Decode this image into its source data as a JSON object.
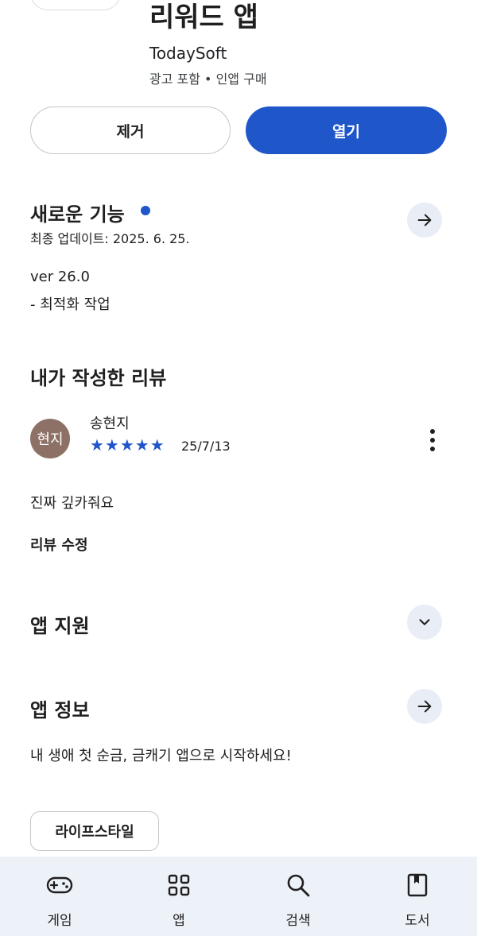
{
  "app": {
    "title": "리워드 앱",
    "developer": "TodaySoft",
    "meta": "광고 포함 • 인앱 구매"
  },
  "buttons": {
    "remove": "제거",
    "open": "열기"
  },
  "whats_new": {
    "title": "새로운 기능",
    "updated": "최종 업데이트: 2025. 6. 25.",
    "version": "ver 26.0",
    "notes": "- 최적화 작업"
  },
  "my_review": {
    "section_title": "내가 작성한 리뷰",
    "avatar_text": "현지",
    "reviewer": "송현지",
    "stars": "★★★★★",
    "rating": 5,
    "date": "25/7/13",
    "text": "진짜 깊카줘요",
    "edit_label": "리뷰 수정"
  },
  "app_support": {
    "title": "앱 지원"
  },
  "app_info": {
    "title": "앱 정보",
    "description": "내 생애 첫 순금, 금캐기 앱으로 시작하세요!",
    "category_chip": "라이프스타일"
  },
  "bottom_nav": {
    "items": [
      {
        "label": "게임",
        "icon": "gamepad-icon"
      },
      {
        "label": "앱",
        "icon": "apps-grid-icon"
      },
      {
        "label": "검색",
        "icon": "search-icon"
      },
      {
        "label": "도서",
        "icon": "book-icon"
      }
    ]
  },
  "colors": {
    "accent": "#1f56c9",
    "circle_button_bg": "#e8edf6",
    "nav_bg": "#edf1f8",
    "avatar_bg": "#8d7166"
  }
}
